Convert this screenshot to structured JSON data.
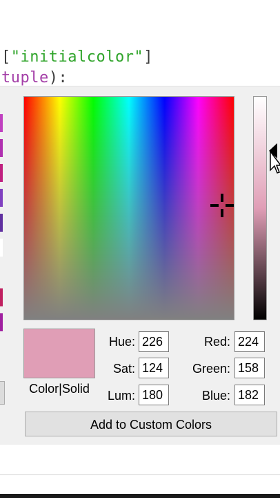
{
  "code": {
    "line1_open": "[",
    "line1_string": "\"initialcolor\"",
    "line1_close": "]",
    "line2_name": "tuple",
    "line2_rest": "):"
  },
  "dialog": {
    "selected_color": "#e09eb6",
    "preview_label": "Color|Solid",
    "fields": {
      "hue_label": "Hue:",
      "hue_value": "226",
      "sat_label": "Sat:",
      "sat_value": "124",
      "lum_label": "Lum:",
      "lum_value": "180",
      "red_label": "Red:",
      "red_value": "224",
      "green_label": "Green:",
      "green_value": "158",
      "blue_label": "Blue:",
      "blue_value": "182"
    },
    "add_button_label": "Add to Custom Colors"
  },
  "icons": {
    "crosshair": "crosshair-icon",
    "lum_pointer": "triangle-left-icon",
    "cursor": "mouse-cursor-icon"
  },
  "colors": {
    "code_string": "#2fa42a",
    "code_name": "#a43fa8",
    "dialog_bg": "#f0f0f0"
  }
}
